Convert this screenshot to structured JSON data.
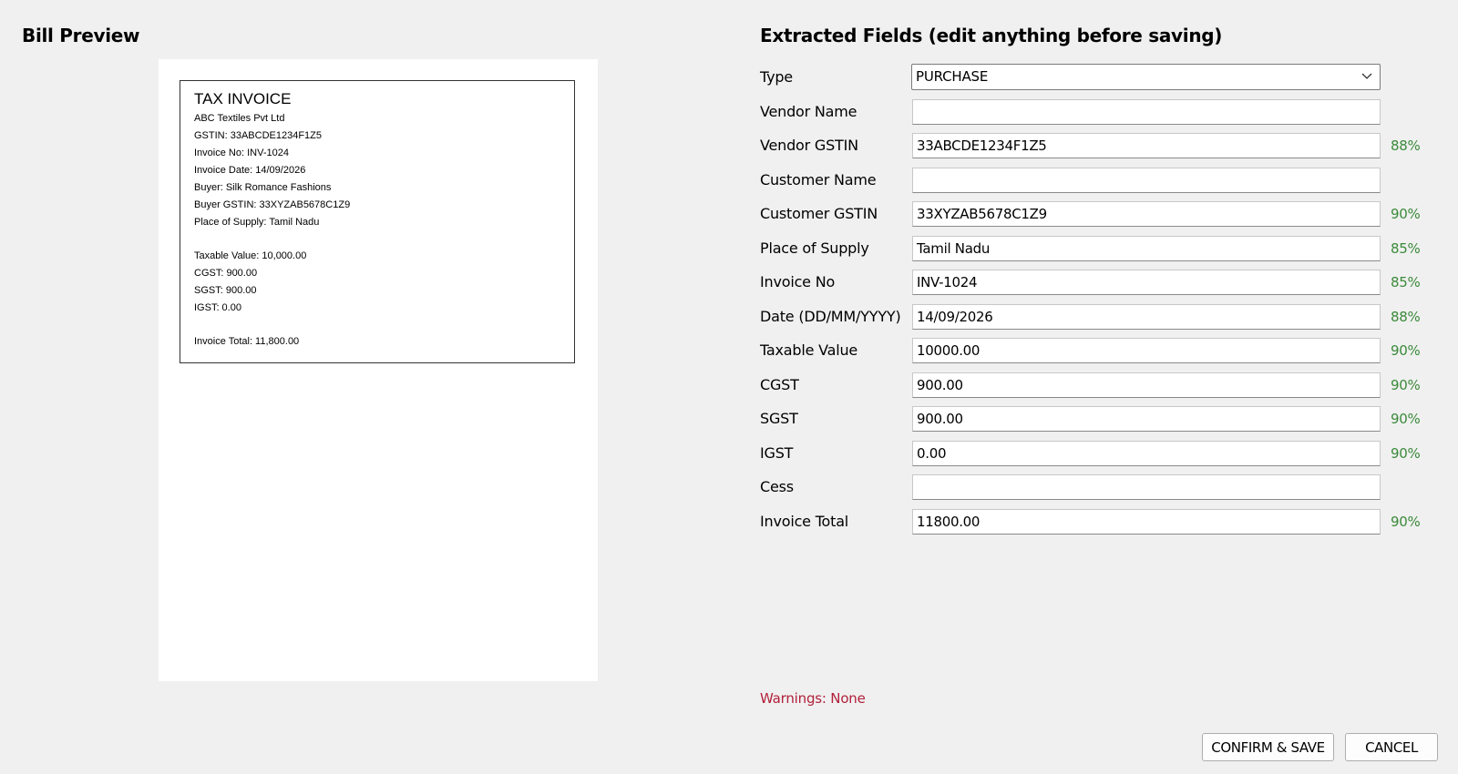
{
  "left": {
    "title": "Bill Preview"
  },
  "bill": {
    "heading": "TAX INVOICE",
    "lines": [
      "ABC Textiles Pvt Ltd",
      "GSTIN: 33ABCDE1234F1Z5",
      "Invoice No: INV-1024",
      "Invoice Date: 14/09/2026",
      "Buyer: Silk Romance Fashions",
      "Buyer GSTIN: 33XYZAB5678C1Z9",
      "Place of Supply: Tamil Nadu",
      "Taxable Value: 10,000.00",
      "CGST: 900.00",
      "SGST: 900.00",
      "IGST: 0.00",
      "Invoice Total: 11,800.00"
    ]
  },
  "right": {
    "title": "Extracted Fields (edit anything before saving)"
  },
  "type_field": {
    "label": "Type",
    "value": "PURCHASE",
    "icon": "chevron-down-icon"
  },
  "fields": [
    {
      "label": "Vendor Name",
      "value": "",
      "confidence": ""
    },
    {
      "label": "Vendor GSTIN",
      "value": "33ABCDE1234F1Z5",
      "confidence": "88%"
    },
    {
      "label": "Customer Name",
      "value": "",
      "confidence": ""
    },
    {
      "label": "Customer GSTIN",
      "value": "33XYZAB5678C1Z9",
      "confidence": "90%"
    },
    {
      "label": "Place of Supply",
      "value": "Tamil Nadu",
      "confidence": "85%"
    },
    {
      "label": "Invoice No",
      "value": "INV-1024",
      "confidence": "85%"
    },
    {
      "label": "Date (DD/MM/YYYY)",
      "value": "14/09/2026",
      "confidence": "88%"
    },
    {
      "label": "Taxable Value",
      "value": "10000.00",
      "confidence": "90%"
    },
    {
      "label": "CGST",
      "value": "900.00",
      "confidence": "90%"
    },
    {
      "label": "SGST",
      "value": "900.00",
      "confidence": "90%"
    },
    {
      "label": "IGST",
      "value": "0.00",
      "confidence": "90%"
    },
    {
      "label": "Cess",
      "value": "",
      "confidence": ""
    },
    {
      "label": "Invoice Total",
      "value": "11800.00",
      "confidence": "90%"
    }
  ],
  "warnings": "Warnings: None",
  "buttons": {
    "confirm": "CONFIRM & SAVE",
    "cancel": "CANCEL"
  },
  "colors": {
    "confidence": "#3a8a3a",
    "warning": "#b1203a",
    "background": "#f0f0f0"
  }
}
